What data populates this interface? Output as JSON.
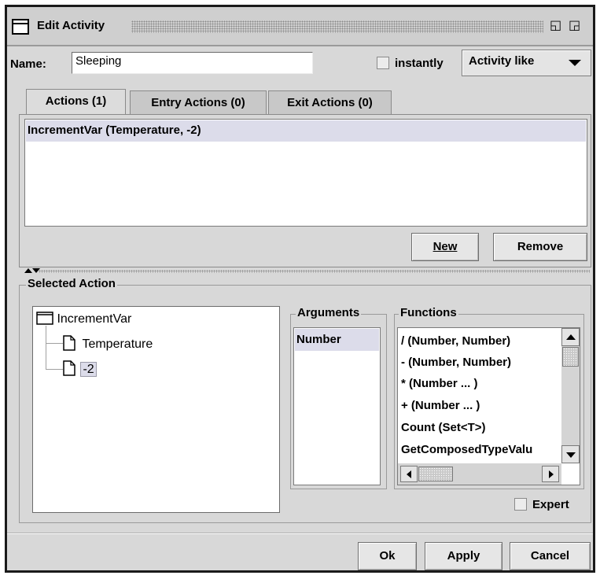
{
  "window": {
    "title": "Edit Activity",
    "restore_icon": "◱",
    "maximize_icon": "◲"
  },
  "name_row": {
    "name_label": "Name:",
    "name_value": "Sleeping",
    "instantly_label": "instantly",
    "instantly_checked": false,
    "activity_type": "Activity like"
  },
  "tabs": [
    {
      "label": "Actions (1)",
      "active": true
    },
    {
      "label": "Entry Actions (0)",
      "active": false
    },
    {
      "label": "Exit Actions (0)",
      "active": false
    }
  ],
  "actions": {
    "items": [
      "IncrementVar (Temperature, -2)"
    ],
    "new_button": "New",
    "remove_button": "Remove"
  },
  "selected_action": {
    "group_title": "Selected Action",
    "tree": {
      "root": "IncrementVar",
      "children": [
        "Temperature",
        "-2"
      ]
    },
    "arguments": {
      "title": "Arguments",
      "items": [
        "Number"
      ]
    },
    "functions": {
      "title": "Functions",
      "items": [
        "/  (Number, Number)",
        "-  (Number, Number)",
        "* (Number ... )",
        "+ (Number ... )",
        "Count (Set<T>)",
        "GetComposedTypeValu"
      ]
    },
    "expert_label": "Expert",
    "expert_checked": false
  },
  "footer": {
    "ok_button": "Ok",
    "apply_button": "Apply",
    "cancel_button": "Cancel"
  },
  "colors": {
    "window_bg": "#d8d8d8",
    "selection_bg": "#dcdcea",
    "border_dark": "#1a1a1a"
  }
}
